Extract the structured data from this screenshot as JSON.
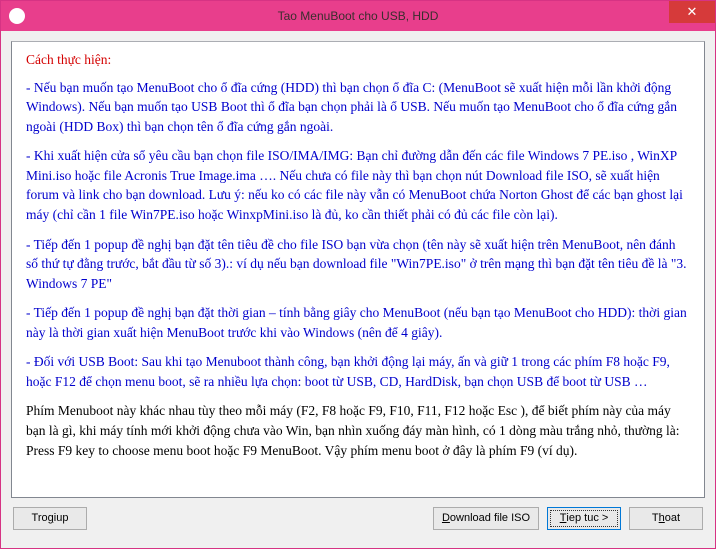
{
  "window": {
    "title": "Tao MenuBoot cho USB, HDD"
  },
  "content": {
    "heading": "Cách thực hiện:",
    "p1": "- Nếu bạn muốn tạo MenuBoot cho ổ đĩa cứng (HDD) thì bạn chọn ổ đĩa C: (MenuBoot sẽ xuất hiện mỗi lần khởi động Windows). Nếu bạn muốn tạo USB Boot thì ổ đĩa bạn chọn phải là ổ USB. Nếu muốn tạo MenuBoot cho ổ đĩa cứng gắn ngoài (HDD Box) thì bạn chọn tên ổ đĩa cứng gắn ngoài.",
    "p2": "- Khi xuất hiện cửa sổ yêu cầu bạn chọn file ISO/IMA/IMG: Bạn chỉ đường dẫn đến các file Windows 7 PE.iso , WinXP Mini.iso hoặc file Acronis True Image.ima …. Nếu chưa có file này thì bạn chọn nút Download file ISO, sẽ xuất hiện forum và link cho bạn download. Lưu ý: nếu ko có các file này vẫn có MenuBoot chứa Norton Ghost để các bạn ghost lại máy (chỉ cần 1 file Win7PE.iso hoặc WinxpMini.iso là đủ, ko cần thiết phải có đủ các file còn lại).",
    "p3": "- Tiếp đến 1 popup đề nghị bạn đặt tên tiêu đề cho file ISO bạn vừa chọn (tên này sẽ xuất hiện trên MenuBoot, nên đánh số thứ tự đằng trước, bắt đầu từ số 3).: ví dụ nếu bạn download file \"Win7PE.iso\" ở trên mạng thì bạn đặt tên tiêu đề là \"3. Windows 7 PE\"",
    "p4": "- Tiếp đến 1 popup đề nghị bạn đặt thời gian – tính bằng giây cho MenuBoot (nếu bạn tạo MenuBoot cho HDD): thời gian này là thời gian xuất hiện MenuBoot trước khi vào Windows (nên để 4 giây).",
    "p5": "- Đối với USB Boot: Sau khi tạo Menuboot thành công, bạn khởi động lại máy, ấn và giữ 1 trong các phím F8 hoặc F9, hoặc F12 để chọn menu boot, sẽ ra nhiều lựa chọn: boot từ USB, CD, HardDisk, bạn chọn USB để boot từ USB …",
    "p6": "Phím Menuboot này khác nhau tùy theo mỗi máy (F2, F8 hoặc F9, F10, F11, F12 hoặc Esc ), để biết phím này của máy bạn là gì, khi máy tính mới khởi động chưa vào Win, bạn nhìn xuống đáy màn hình, có 1 dòng màu trắng nhỏ, thường là: Press F9 key to choose menu boot hoặc F9 MenuBoot. Vậy phím menu boot ở đây là phím F9 (ví dụ)."
  },
  "buttons": {
    "help_pre": "Tro ",
    "help_key": "g",
    "help_post": "iup",
    "download_pre": "",
    "download_key": "D",
    "download_post": "ownload file ISO",
    "next_pre": "",
    "next_key": "T",
    "next_post": "iep tuc >",
    "exit_pre": "T",
    "exit_key": "h",
    "exit_post": "oat"
  }
}
